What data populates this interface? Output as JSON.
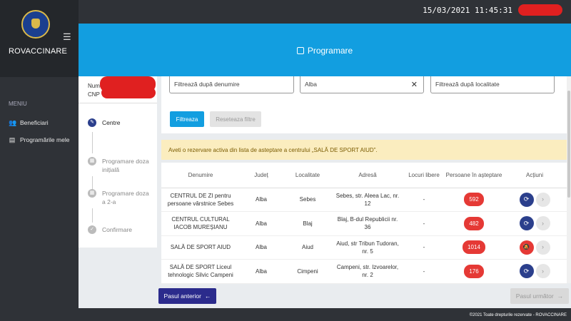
{
  "app": {
    "brand": "ROVACCINARE",
    "datetime": "15/03/2021 11:45:31",
    "header_title": "Programare"
  },
  "sidebar": {
    "menu_title": "MENIU",
    "items": [
      {
        "label": "Beneficiari",
        "icon": "users-icon"
      },
      {
        "label": "Programările mele",
        "icon": "document-icon"
      }
    ]
  },
  "user": {
    "name_label": "Nume",
    "cnp_label": "CNP"
  },
  "steps": [
    {
      "label": "Centre"
    },
    {
      "label": "Programare doza inițială"
    },
    {
      "label": "Programare doza a 2-a"
    },
    {
      "label": "Confirmare"
    }
  ],
  "filters": {
    "name_placeholder": "Filtrează după denumire",
    "county_value": "Alba",
    "locality_placeholder": "Filtrează după localitate",
    "filter_button": "Filtreaza",
    "reset_button": "Reseteaza filtre"
  },
  "alert": "Aveti o rezervare activa din lista de asteptare a centrului „SALĂ DE SPORT AIUD”.",
  "table": {
    "headers": [
      "Denumire",
      "Județ",
      "Localitate",
      "Adresă",
      "Locuri libere",
      "Persoane în așteptare",
      "Acțiuni"
    ],
    "rows": [
      {
        "name": "CENTRUL DE ZI pentru persoane vârstnice Sebes",
        "county": "Alba",
        "locality": "Sebes",
        "address": "Sebes, str. Aleea Lac, nr. 12",
        "free": "-",
        "waiting": "592"
      },
      {
        "name": "CENTRUL CULTURAL IACOB MUREȘIANU",
        "county": "Alba",
        "locality": "Blaj",
        "address": "Blaj, B-dul Republicii nr. 36",
        "free": "-",
        "waiting": "482"
      },
      {
        "name": "SALĂ DE SPORT AIUD",
        "county": "Alba",
        "locality": "Aiud",
        "address": "Aiud, str Tribun Tudoran, nr. 5",
        "free": "-",
        "waiting": "1014"
      },
      {
        "name": "SALĂ DE SPORT Liceul tehnologic Silvic Campeni",
        "county": "Alba",
        "locality": "Cimpeni",
        "address": "Campeni, str. Izvoarelor, nr. 2",
        "free": "-",
        "waiting": "176"
      }
    ]
  },
  "nav": {
    "prev": "Pasul anterior",
    "next": "Pasul următor"
  },
  "footer": {
    "copyright": "©2021 Toate drepturile rezervate - ROVACCINARE"
  }
}
